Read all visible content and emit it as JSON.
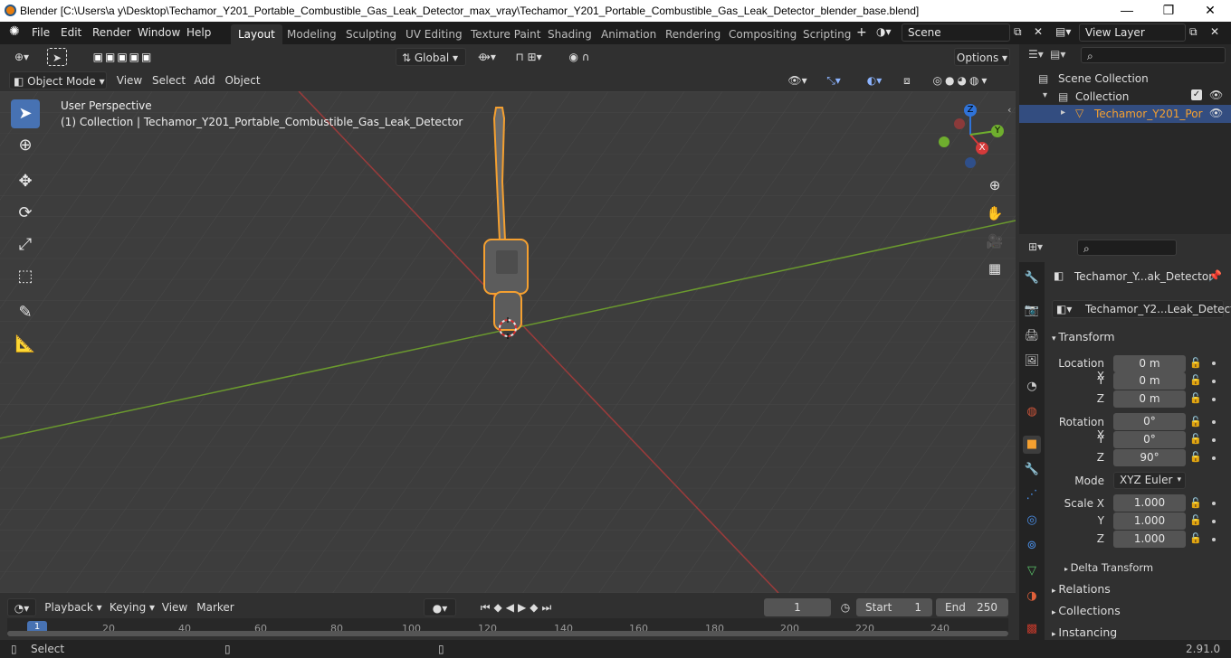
{
  "window": {
    "title": "Blender [C:\\Users\\a y\\Desktop\\Techamor_Y201_Portable_Combustible_Gas_Leak_Detector_max_vray\\Techamor_Y201_Portable_Combustible_Gas_Leak_Detector_blender_base.blend]",
    "minimize": "—",
    "maximize": "❐",
    "close": "✕"
  },
  "menu": {
    "file": "File",
    "edit": "Edit",
    "render": "Render",
    "window": "Window",
    "help": "Help"
  },
  "workspaces": [
    "Layout",
    "Modeling",
    "Sculpting",
    "UV Editing",
    "Texture Paint",
    "Shading",
    "Animation",
    "Rendering",
    "Compositing",
    "Scripting"
  ],
  "add_workspace": "+",
  "scene": {
    "label": "Scene",
    "view_layer": "View Layer"
  },
  "viewport": {
    "mode": "Object Mode",
    "view": "View",
    "select": "Select",
    "add": "Add",
    "object": "Object",
    "orientation": "Global",
    "options": "Options",
    "perspective_label": "User Perspective",
    "collection_label": "(1) Collection | Techamor_Y201_Portable_Combustible_Gas_Leak_Detector",
    "gizmo": {
      "x": "X",
      "y": "Y",
      "z": "Z"
    }
  },
  "outliner": {
    "scene_collection": "Scene Collection",
    "collection": "Collection",
    "object": "Techamor_Y201_Por"
  },
  "properties": {
    "object_name": "Techamor_Y...ak_Detector",
    "data_name": "Techamor_Y2...Leak_Detector",
    "transform": "Transform",
    "location_x_label": "Location X",
    "location_x": "0 m",
    "location_y_label": "Y",
    "location_y": "0 m",
    "location_z_label": "Z",
    "location_z": "0 m",
    "rotation_x_label": "Rotation X",
    "rotation_x": "0°",
    "rotation_y_label": "Y",
    "rotation_y": "0°",
    "rotation_z_label": "Z",
    "rotation_z": "90°",
    "mode_label": "Mode",
    "mode": "XYZ Euler",
    "scale_x_label": "Scale X",
    "scale_x": "1.000",
    "scale_y_label": "Y",
    "scale_y": "1.000",
    "scale_z_label": "Z",
    "scale_z": "1.000",
    "delta_transform": "Delta Transform",
    "relations": "Relations",
    "collections": "Collections",
    "instancing": "Instancing"
  },
  "timeline": {
    "playback": "Playback",
    "keying": "Keying",
    "view": "View",
    "marker": "Marker",
    "current_frame": "1",
    "start_label": "Start",
    "start": "1",
    "end_label": "End",
    "end": "250",
    "ticks": [
      "1",
      "20",
      "40",
      "60",
      "80",
      "100",
      "120",
      "140",
      "160",
      "180",
      "200",
      "220",
      "240"
    ]
  },
  "status": {
    "select": "Select",
    "version": "2.91.0"
  },
  "colors": {
    "accent": "#4772b3",
    "selection": "#f5a030",
    "x_axis": "#9c3b3b",
    "y_axis": "#6b9a2e"
  }
}
